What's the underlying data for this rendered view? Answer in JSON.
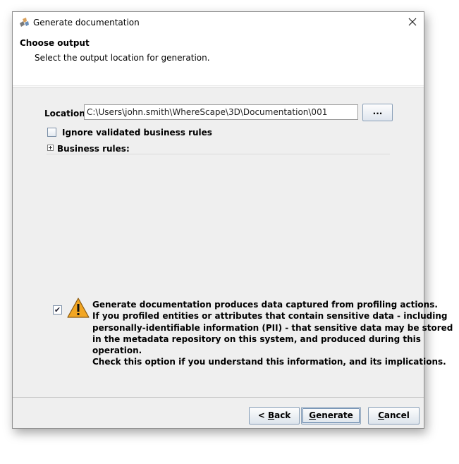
{
  "window": {
    "title": "Generate documentation",
    "close_glyph": "✕"
  },
  "header": {
    "title": "Choose output",
    "subtitle": "Select the output location for generation."
  },
  "location": {
    "label": "Location:",
    "value": "C:\\Users\\john.smith\\WhereScape\\3D\\Documentation\\001",
    "browse_label": "..."
  },
  "ignore_rules": {
    "label": "Ignore validated business rules",
    "checked": false
  },
  "business_rules": {
    "label": "Business rules:",
    "expanded": false
  },
  "warning": {
    "checked": true,
    "check_glyph": "✔",
    "lines": [
      "Generate documentation produces data captured from profiling actions.",
      "If you profiled entities or attributes that contain sensitive data - including",
      "personally-identifiable information (PII) - that sensitive data may be stored",
      "in the metadata repository on this system, and produced during this",
      "operation.",
      "Check this option if you understand this information, and its implications."
    ]
  },
  "buttons": {
    "back": {
      "prefix": "< ",
      "mnemonic": "B",
      "rest": "ack"
    },
    "generate": {
      "mnemonic": "G",
      "rest": "enerate"
    },
    "cancel": {
      "mnemonic": "C",
      "rest": "ancel"
    }
  },
  "icons": {
    "app": "app-icon",
    "close": "close-icon",
    "expander": "plus-expander-icon",
    "warning": "warning-icon"
  },
  "colors": {
    "dialog_bg": "#efefef",
    "warning_fill": "#f2a623",
    "button_border": "#8aa0b8"
  }
}
